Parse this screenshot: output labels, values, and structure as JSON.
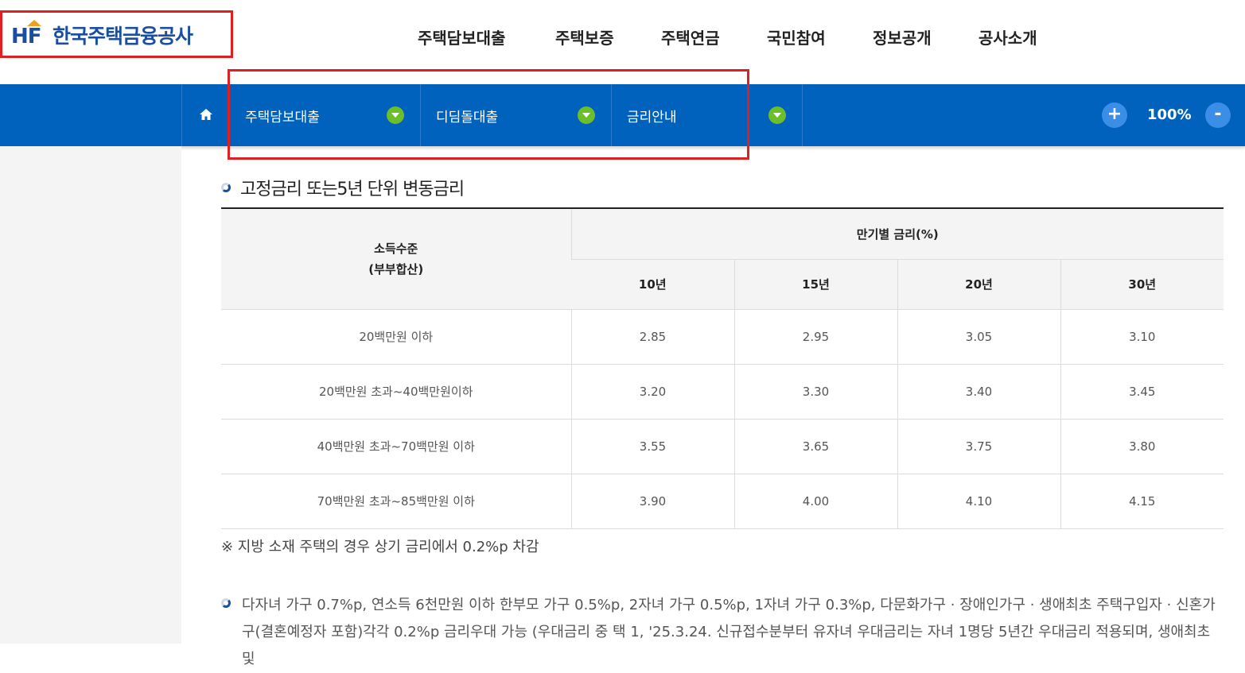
{
  "header": {
    "logo_mark": "HF",
    "logo_text": "한국주택금융공사",
    "gnb": [
      "주택담보대출",
      "주택보증",
      "주택연금",
      "국민참여",
      "정보공개",
      "공사소개"
    ]
  },
  "location_bar": {
    "items": [
      "주택담보대출",
      "디딤돌대출",
      "금리안내"
    ],
    "zoom_in": "+",
    "zoom_value": "100%",
    "zoom_out": "-"
  },
  "section": {
    "title": "고정금리 또는5년 단위 변동금리"
  },
  "table": {
    "income_header_line1": "소득수준",
    "income_header_line2": "(부부합산)",
    "rate_header": "만기별 금리(%)",
    "terms": [
      "10년",
      "15년",
      "20년",
      "30년"
    ],
    "rows": [
      {
        "income": "20백만원 이하",
        "rates": [
          "2.85",
          "2.95",
          "3.05",
          "3.10"
        ]
      },
      {
        "income": "20백만원 초과~40백만원이하",
        "rates": [
          "3.20",
          "3.30",
          "3.40",
          "3.45"
        ]
      },
      {
        "income": "40백만원 초과~70백만원 이하",
        "rates": [
          "3.55",
          "3.65",
          "3.75",
          "3.80"
        ]
      },
      {
        "income": "70백만원 초과~85백만원 이하",
        "rates": [
          "3.90",
          "4.00",
          "4.10",
          "4.15"
        ]
      }
    ]
  },
  "note": "※ 지방 소재 주택의 경우 상기 금리에서 0.2%p 차감",
  "paragraph": "다자녀 가구 0.7%p, 연소득 6천만원 이하 한부모 가구 0.5%p, 2자녀 가구 0.5%p, 1자녀 가구 0.3%p, 다문화가구 · 장애인가구 · 생애최초 주택구입자 · 신혼가구(결혼예정자 포함)각각 0.2%p 금리우대 가능 (우대금리 중 택 1, '25.3.24. 신규접수분부터 유자녀 우대금리는 자녀 1명당 5년간 우대금리 적용되며, 생애최초 및",
  "colors": {
    "brand_blue": "#1a4fa0",
    "bar_blue": "#0062bd",
    "caret_green": "#6bbf2a",
    "highlight_red": "#e02020"
  }
}
